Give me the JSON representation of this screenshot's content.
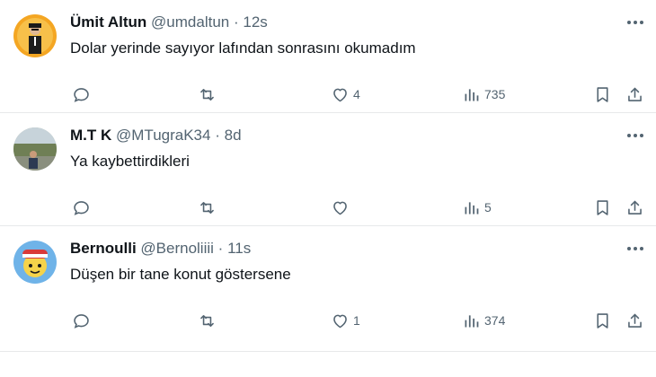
{
  "tweets": [
    {
      "name": "Ümit Altun",
      "handle": "@umdaltun",
      "separator": "·",
      "time": "12s",
      "text": "Dolar yerinde sayıyor lafından sonrasını okumadım",
      "replies": "",
      "retweets": "",
      "likes": "4",
      "views": "735",
      "avatar_colors": [
        "#f2b233",
        "#2b2b2b"
      ]
    },
    {
      "name": "M.T K",
      "handle": "@MTugraK34",
      "separator": "·",
      "time": "8d",
      "text": "Ya kaybettirdikleri",
      "replies": "",
      "retweets": "",
      "likes": "",
      "views": "5",
      "avatar_colors": [
        "#7a8a6a",
        "#c9d2d9"
      ]
    },
    {
      "name": "Bernoulli",
      "handle": "@Bernoliiii",
      "separator": "·",
      "time": "11s",
      "text": "Düşen bir tane konut göstersene",
      "replies": "",
      "retweets": "",
      "likes": "1",
      "views": "374",
      "avatar_colors": [
        "#4a90d9",
        "#f5d34a"
      ]
    }
  ],
  "icons": [
    "reply-icon",
    "retweet-icon",
    "like-icon",
    "views-icon",
    "bookmark-icon",
    "share-icon",
    "more-icon"
  ],
  "colors": {
    "text": "#0f1419",
    "secondary": "#536471",
    "divider": "#e7e9ea"
  }
}
